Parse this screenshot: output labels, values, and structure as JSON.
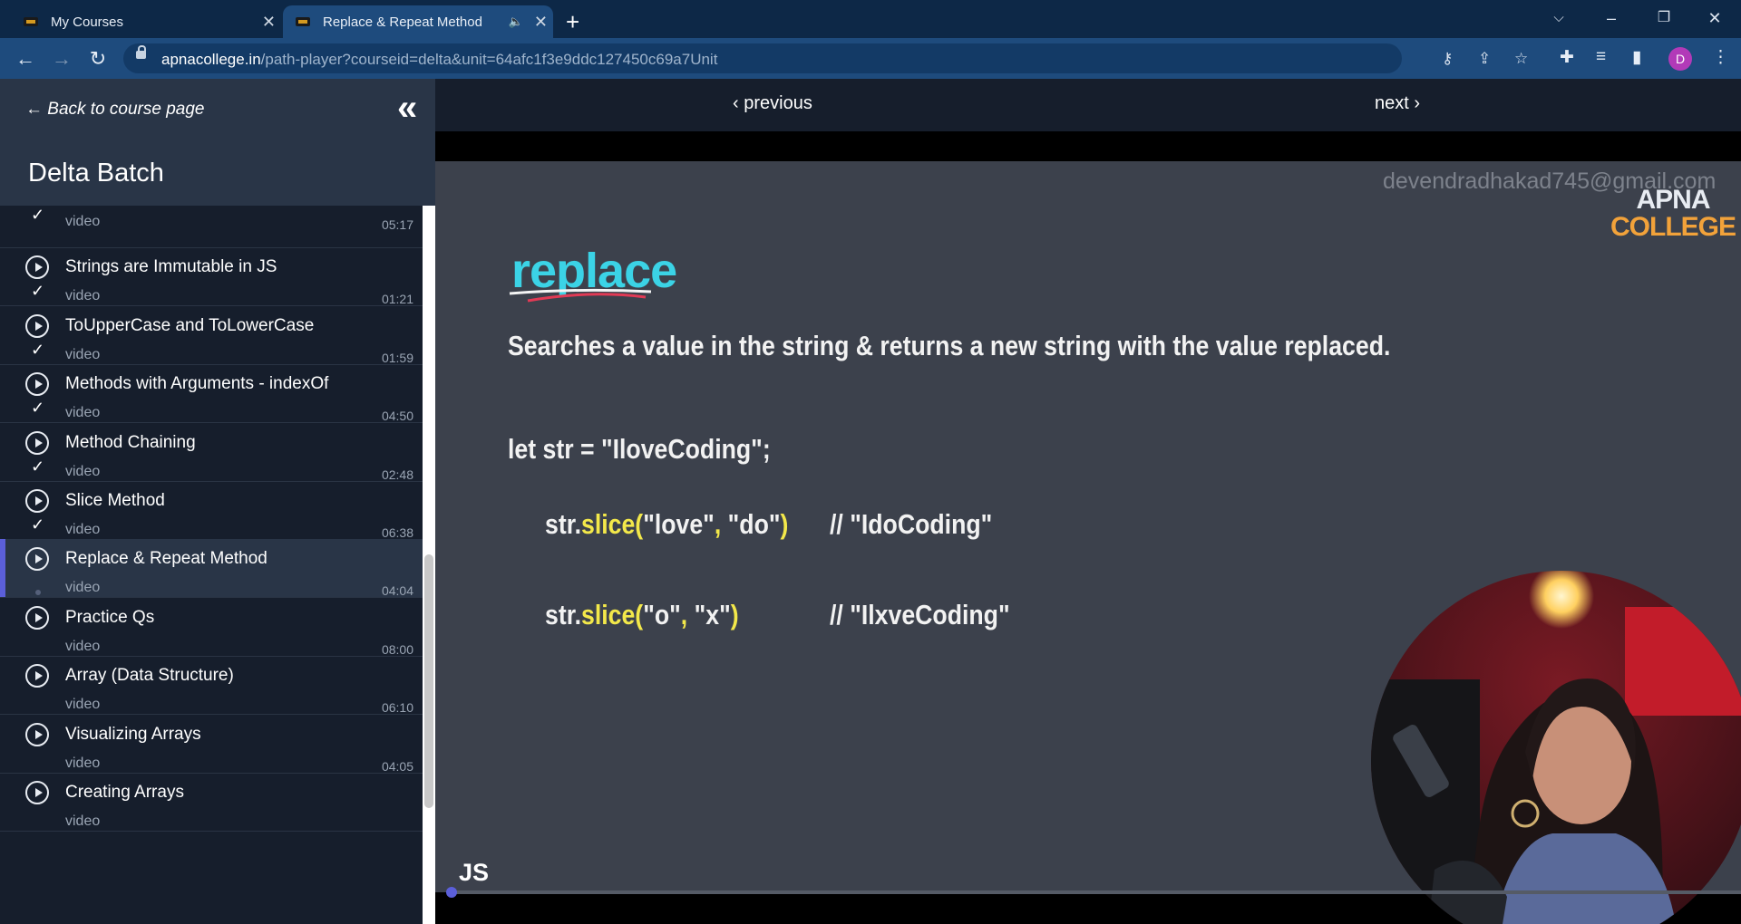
{
  "browser": {
    "tabs": [
      {
        "title": "My Courses",
        "active": false
      },
      {
        "title": "Replace & Repeat Method",
        "active": true,
        "audio": true
      }
    ],
    "url_host": "apnacollege.in",
    "url_path": "/path-player?courseid=delta&unit=64afc1f3e9ddc127450c69a7Unit",
    "profile_initial": "D",
    "accent_color": "#5b5fd9"
  },
  "sidebar": {
    "back_label": "← Back to course page",
    "course_title": "Delta Batch",
    "items": [
      {
        "title": "",
        "type": "video",
        "duration": "05:17",
        "status": "done"
      },
      {
        "title": "Strings are Immutable in JS",
        "type": "video",
        "duration": "01:21",
        "status": "done"
      },
      {
        "title": "ToUpperCase and ToLowerCase",
        "type": "video",
        "duration": "01:59",
        "status": "done"
      },
      {
        "title": "Methods with Arguments - indexOf",
        "type": "video",
        "duration": "04:50",
        "status": "done"
      },
      {
        "title": "Method Chaining",
        "type": "video",
        "duration": "02:48",
        "status": "done"
      },
      {
        "title": "Slice Method",
        "type": "video",
        "duration": "06:38",
        "status": "done"
      },
      {
        "title": "Replace & Repeat Method",
        "type": "video",
        "duration": "04:04",
        "status": "current"
      },
      {
        "title": "Practice Qs",
        "type": "video",
        "duration": "08:00",
        "status": "none"
      },
      {
        "title": "Array (Data Structure)",
        "type": "video",
        "duration": "06:10",
        "status": "none"
      },
      {
        "title": "Visualizing Arrays",
        "type": "video",
        "duration": "04:05",
        "status": "none"
      },
      {
        "title": "Creating Arrays",
        "type": "video",
        "duration": "",
        "status": "none"
      }
    ]
  },
  "nav": {
    "previous": "previous",
    "next": "next"
  },
  "slide": {
    "watermark": "devendradhakad745@gmail.com",
    "logo_line1": "APNA",
    "logo_line2": "COLLEGE",
    "title": "replace",
    "description": "Searches a value in the string & returns a new string with the value replaced.",
    "code_decl": "let str = \"IloveCoding\";",
    "line1": {
      "obj": "str.",
      "method": "slice(",
      "args1": "\"love\"",
      "sep": ", ",
      "args2": "\"do\"",
      "close": ")",
      "comment": "// \"IdoCoding\""
    },
    "line2": {
      "obj": "str.",
      "method": "slice(",
      "args1": "\"o\"",
      "sep": ", ",
      "args2": "\"x\"",
      "close": ")",
      "comment": "// \"IlxveCoding\""
    },
    "badge": "JS"
  },
  "player": {
    "progress": 0.003
  }
}
